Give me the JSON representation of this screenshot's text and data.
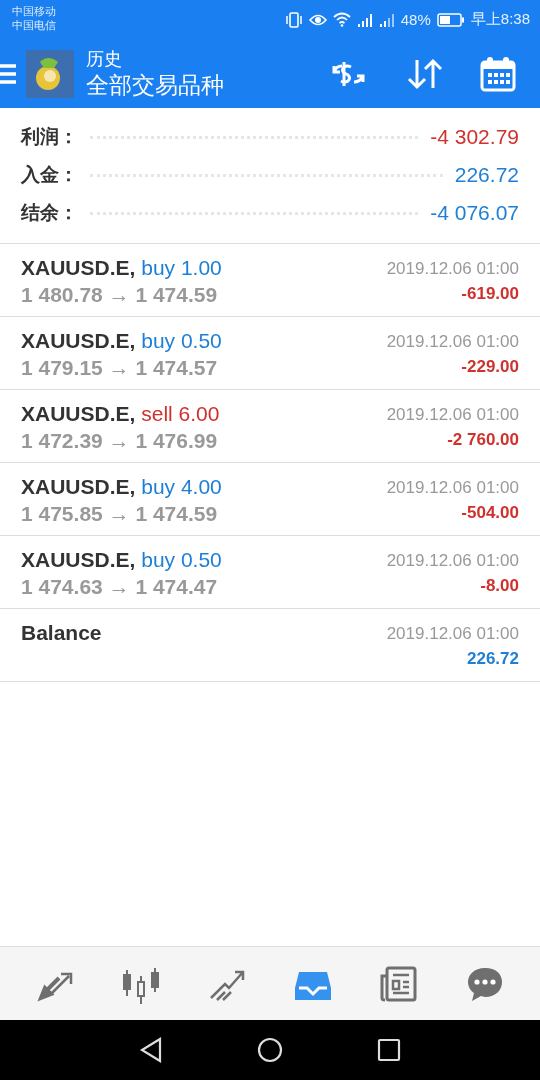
{
  "status_bar": {
    "carriers": [
      "中国移动",
      "中国电信"
    ],
    "battery": "48%",
    "time": "早上8:38"
  },
  "app_bar": {
    "title": "历史",
    "subtitle": "全部交易品种"
  },
  "summary": [
    {
      "label": "利润：",
      "value": "-4 302.79",
      "color": "#d0312d"
    },
    {
      "label": "入金：",
      "value": "226.72",
      "color": "#1e7fd6"
    },
    {
      "label": "结余：",
      "value": "-4 076.07",
      "color": "#1e7fd6"
    }
  ],
  "deals": [
    {
      "kind": "trade",
      "symbol": "XAUUSD.E,",
      "action": {
        "text": "buy 1.00",
        "color": "#1e7fd6"
      },
      "prices": "1 480.78 → 1 474.59",
      "time": "2019.12.06 01:00",
      "profit": "-619.00",
      "color": "#d0312d"
    },
    {
      "kind": "trade",
      "symbol": "XAUUSD.E,",
      "action": {
        "text": "buy 0.50",
        "color": "#1e7fd6"
      },
      "prices": "1 479.15 → 1 474.57",
      "time": "2019.12.06 01:00",
      "profit": "-229.00",
      "color": "#d0312d"
    },
    {
      "kind": "trade",
      "symbol": "XAUUSD.E,",
      "action": {
        "text": "sell 6.00",
        "color": "#d0312d"
      },
      "prices": "1 472.39 → 1 476.99",
      "time": "2019.12.06 01:00",
      "profit": "-2 760.00",
      "color": "#d0312d"
    },
    {
      "kind": "trade",
      "symbol": "XAUUSD.E,",
      "action": {
        "text": "buy 4.00",
        "color": "#1e7fd6"
      },
      "prices": "1 475.85 → 1 474.59",
      "time": "2019.12.06 01:00",
      "profit": "-504.00",
      "color": "#d0312d"
    },
    {
      "kind": "trade",
      "symbol": "XAUUSD.E,",
      "action": {
        "text": "buy 0.50",
        "color": "#1e7fd6"
      },
      "prices": "1 474.63 → 1 474.47",
      "time": "2019.12.06 01:00",
      "profit": "-8.00",
      "color": "#d0312d"
    },
    {
      "kind": "balance",
      "symbol": "Balance",
      "time": "2019.12.06 01:00",
      "profit": "226.72",
      "color": "#1e7fd6"
    }
  ],
  "bottom_nav": [
    {
      "kind": "quotes",
      "selected": false
    },
    {
      "kind": "chart",
      "selected": false
    },
    {
      "kind": "trade",
      "selected": false
    },
    {
      "kind": "history",
      "selected": true
    },
    {
      "kind": "news",
      "selected": false
    },
    {
      "kind": "chat",
      "selected": false
    }
  ]
}
